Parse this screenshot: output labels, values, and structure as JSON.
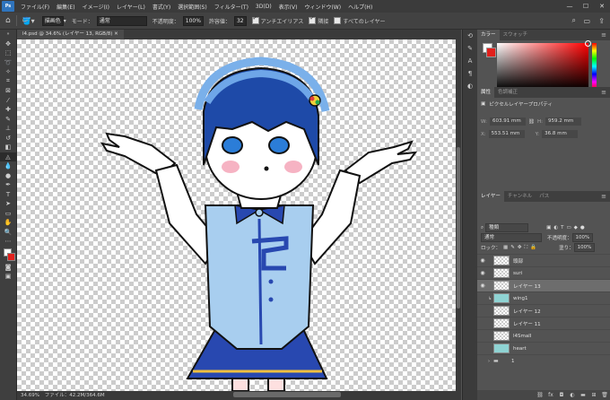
{
  "menu": {
    "logo": "Ps",
    "items": [
      "ファイル(F)",
      "編集(E)",
      "イメージ(I)",
      "レイヤー(L)",
      "書式(Y)",
      "選択範囲(S)",
      "フィルター(T)",
      "3D(D)",
      "表示(V)",
      "ウィンドウ(W)",
      "ヘルプ(H)"
    ],
    "window_controls": [
      "—",
      "☐",
      "✕"
    ]
  },
  "options": {
    "tool_icon": "paint-bucket-icon",
    "source": "描画色",
    "mode_label": "モード：",
    "mode_value": "通常",
    "opacity_label": "不透明度：",
    "opacity_value": "100%",
    "tolerance_label": "許容値：",
    "tolerance_value": "32",
    "antialias_label": "アンチエイリアス",
    "contiguous_label": "隣接",
    "all_layers_label": "すべてのレイヤー"
  },
  "document": {
    "tab_label": "l4.psd @ 34.6% (レイヤー 13, RGB/8) ✕"
  },
  "status": {
    "zoom": "34.69%",
    "file_info": "ファイル：42.2M/364.6M"
  },
  "color_panel": {
    "tabs": [
      "カラー",
      "スウォッチ"
    ],
    "foreground": "#ffffff",
    "background": "#e2201c"
  },
  "properties_panel": {
    "tabs": [
      "属性",
      "色調補正"
    ],
    "title": "ピクセルレイヤープロパティ",
    "w_label": "W:",
    "w_value": "603.91 mm",
    "h_label": "H:",
    "h_value": "959.2 mm",
    "x_label": "X:",
    "x_value": "553.51 mm",
    "y_label": "Y:",
    "y_value": "36.8 mm"
  },
  "layers_panel": {
    "tabs": [
      "レイヤー",
      "チャンネル",
      "パス"
    ],
    "filter_kind": "種類",
    "blend_mode": "通常",
    "opacity_label": "不透明度：",
    "opacity_value": "100%",
    "lock_label": "ロック：",
    "fill_label": "塗り：",
    "fill_value": "100%",
    "layers": [
      {
        "name": "頭部"
      },
      {
        "name": "suri"
      },
      {
        "name": "レイヤー 13"
      },
      {
        "name": "wing1"
      },
      {
        "name": "レイヤー 12"
      },
      {
        "name": "レイヤー 11"
      },
      {
        "name": "l4Small"
      },
      {
        "name": "heart"
      },
      {
        "name": "1"
      }
    ]
  }
}
